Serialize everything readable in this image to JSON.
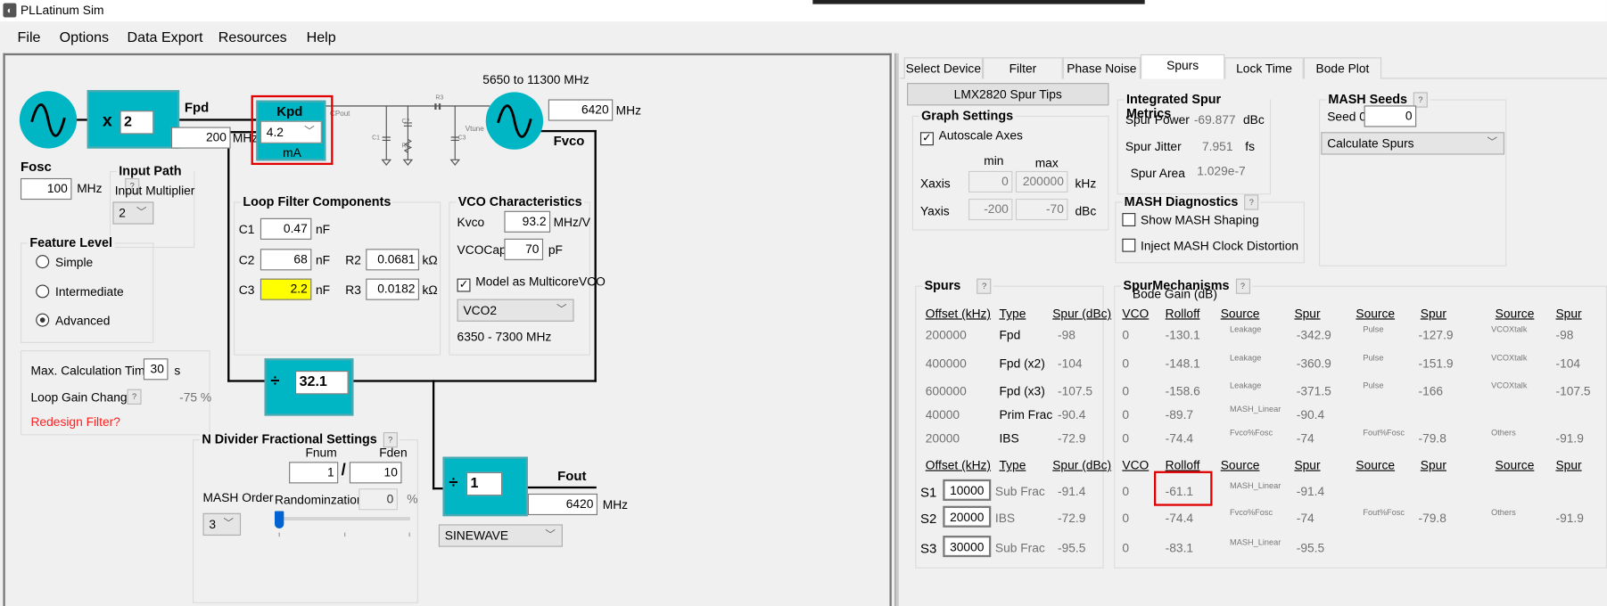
{
  "window": {
    "title": "PLLatinum Sim"
  },
  "menu": [
    "File",
    "Options",
    "Data Export",
    "Resources",
    "Help"
  ],
  "colors": {
    "accent": "#00b6c4",
    "highlight": "#ffff00",
    "warning": "#ff0000",
    "annotation": "#e00000"
  },
  "diagram": {
    "multiplier_value": "2",
    "x_label": "x",
    "fpd_label": "Fpd",
    "fpd_value": "200",
    "mhz": "MHz",
    "kpd_label": "Kpd",
    "kpd_value": "4.2",
    "kpd_unit": "mA",
    "cpout": "CPout",
    "vtune": "Vtune",
    "c1": "C1",
    "c2": "C2",
    "c3": "C3",
    "r2": "R2",
    "r3": "R3",
    "vco_range": "5650 to 11300 MHz",
    "fvco_value": "6420",
    "fvco_label": "Fvco",
    "fosc_label": "Fosc",
    "fosc_value": "100",
    "n_div_symbol": "÷",
    "n_div_value": "32.1",
    "out_div_value": "1",
    "fout_label": "Fout",
    "fout_value": "6420",
    "output_format": "SINEWAVE"
  },
  "input_path": {
    "title": "Input Path",
    "help": "?",
    "multiplier_label": "Input Multiplier",
    "multiplier_value": "2"
  },
  "feature_level": {
    "title": "Feature Level",
    "options": [
      "Simple",
      "Intermediate",
      "Advanced"
    ],
    "selected": "Advanced"
  },
  "calc": {
    "max_time_label": "Max. Calculation Time",
    "max_time_value": "30",
    "max_time_unit": "s",
    "loop_gain_label": "Loop Gain Change",
    "help": "?",
    "loop_gain_value": "-75 %",
    "redesign": "Redesign Filter?"
  },
  "loop_filter": {
    "title": "Loop Filter Components",
    "c1": {
      "label": "C1",
      "value": "0.47",
      "unit": "nF"
    },
    "c2": {
      "label": "C2",
      "value": "68",
      "unit": "nF"
    },
    "c3": {
      "label": "C3",
      "value": "2.2",
      "unit": "nF"
    },
    "r2": {
      "label": "R2",
      "value": "0.0681",
      "unit": "kΩ"
    },
    "r3": {
      "label": "R3",
      "value": "0.0182",
      "unit": "kΩ"
    }
  },
  "vco": {
    "title": "VCO Characteristics",
    "kvco_label": "Kvco",
    "kvco_value": "93.2",
    "kvco_unit": "MHz/V",
    "vcocap_label": "VCOCap",
    "vcocap_value": "70",
    "vcocap_unit": "pF",
    "multicore_label": "Model as MulticoreVCO",
    "multicore_checked": true,
    "core": "VCO2",
    "core_range": "6350 - 7300 MHz"
  },
  "n_frac": {
    "title": "N Divider Fractional Settings",
    "help": "?",
    "fnum_label": "Fnum",
    "fden_label": "Fden",
    "fnum": "1",
    "slash": "/",
    "fden": "10",
    "mash_label": "MASH Order",
    "mash_value": "3",
    "rand_label": "Randominzation",
    "rand_value": "0",
    "rand_unit": "%",
    "slider_level": 0
  },
  "tabs": [
    "Select Device",
    "Filter Designer",
    "Phase Noise",
    "Spurs",
    "Lock Time",
    "Bode Plot"
  ],
  "active_tab": "Spurs",
  "spur_tips_button": "LMX2820 Spur Tips",
  "graph": {
    "title": "Graph Settings",
    "autoscale": "Autoscale Axes",
    "autoscale_checked": true,
    "min": "min",
    "max": "max",
    "xaxis": "Xaxis",
    "xmin": "0",
    "xmax": "200000",
    "xunit": "kHz",
    "yaxis": "Yaxis",
    "ymin": "-200",
    "ymax": "-70",
    "yunit": "dBc"
  },
  "metrics": {
    "title": "Integrated Spur Metrics",
    "power_label": "Spur Power",
    "power": "-69.877",
    "power_unit": "dBc",
    "jitter_label": "Spur Jitter",
    "jitter": "7.951",
    "jitter_unit": "fs",
    "area_label": "Spur Area",
    "area": "1.029e-7"
  },
  "mash_diag": {
    "title": "MASH Diagnostics",
    "help": "?",
    "shaping": "Show MASH Shaping",
    "inject": "Inject MASH Clock Distortion"
  },
  "mash_seeds": {
    "title": "MASH Seeds",
    "help": "?",
    "seed_label": "Seed 0",
    "seed_value": "0",
    "action": "Calculate Spurs"
  },
  "spurs": {
    "title": "Spurs",
    "help": "?",
    "headers": [
      "Offset (kHz)",
      "Type",
      "Spur (dBc)"
    ],
    "rows": [
      [
        "200000",
        "Fpd",
        "-98"
      ],
      [
        "400000",
        "Fpd (x2)",
        "-104"
      ],
      [
        "600000",
        "Fpd (x3)",
        "-107.5"
      ],
      [
        "40000",
        "Prim Frac",
        "-90.4"
      ],
      [
        "20000",
        "IBS",
        "-72.9"
      ]
    ],
    "user_rows": [
      [
        "S1",
        "10000",
        "Sub Frac",
        "-91.4"
      ],
      [
        "S2",
        "20000",
        "IBS",
        "-72.9"
      ],
      [
        "S3",
        "30000",
        "Sub Frac",
        "-95.5"
      ]
    ]
  },
  "mechanisms": {
    "title": "SpurMechanisms",
    "help": "?",
    "subtitle": "Bode Gain (dB)",
    "headers": [
      "VCO",
      "Rolloff",
      "Source",
      "Spur",
      "Source",
      "Spur",
      "Source",
      "Spur"
    ],
    "rows": [
      [
        "0",
        "-130.1",
        "Leakage",
        "-342.9",
        "Pulse",
        "-127.9",
        "VCOXtalk",
        "-98"
      ],
      [
        "0",
        "-148.1",
        "Leakage",
        "-360.9",
        "Pulse",
        "-151.9",
        "VCOXtalk",
        "-104"
      ],
      [
        "0",
        "-158.6",
        "Leakage",
        "-371.5",
        "Pulse",
        "-166",
        "VCOXtalk",
        "-107.5"
      ],
      [
        "0",
        "-89.7",
        "MASH_Linear",
        "-90.4",
        "",
        "",
        "",
        ""
      ],
      [
        "0",
        "-74.4",
        "Fvco%Fosc",
        "-74",
        "Fout%Fosc",
        "-79.8",
        "Others",
        "-91.9"
      ]
    ],
    "user_rows": [
      [
        "0",
        "-61.1",
        "MASH_Linear",
        "-91.4",
        "",
        "",
        "",
        ""
      ],
      [
        "0",
        "-74.4",
        "Fvco%Fosc",
        "-74",
        "Fout%Fosc",
        "-79.8",
        "Others",
        "-91.9"
      ],
      [
        "0",
        "-83.1",
        "MASH_Linear",
        "-95.5",
        "",
        "",
        "",
        ""
      ]
    ]
  }
}
